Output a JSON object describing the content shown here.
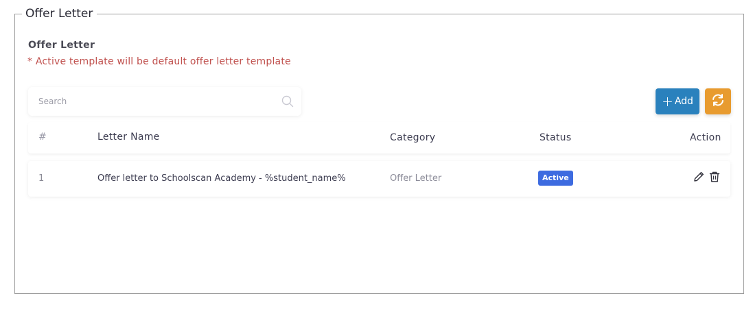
{
  "fieldset": {
    "legend": "Offer Letter"
  },
  "section": {
    "title": "Offer Letter",
    "note": "* Active template will be default offer letter template"
  },
  "search": {
    "placeholder": "Search",
    "icon": "search-icon"
  },
  "toolbar": {
    "add_label": "Add",
    "add_icon": "plus-icon",
    "refresh_icon": "refresh-icon",
    "add_color": "#2a81bd",
    "refresh_color": "#e89b2f"
  },
  "table": {
    "columns": [
      "#",
      "Letter Name",
      "Category",
      "Status",
      "Action"
    ],
    "rows": [
      {
        "num": "1",
        "letter_name": "Offer letter to Schoolscan Academy - %student_name%",
        "category": "Offer Letter",
        "status": "Active",
        "status_color": "#3d6be0",
        "actions": [
          "edit-icon",
          "delete-icon"
        ]
      }
    ]
  }
}
